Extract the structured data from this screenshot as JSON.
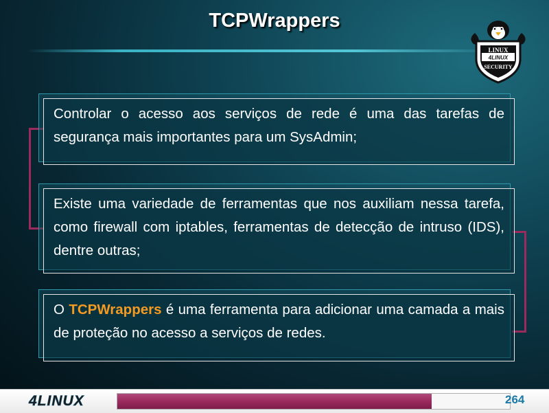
{
  "slide": {
    "title": "TCPWrappers",
    "badge": {
      "top_text": "LINUX",
      "middle_text": "4LINUX",
      "bottom_text": "SECURITY"
    }
  },
  "content": {
    "items": [
      {
        "text": "Controlar o acesso aos serviços de rede é uma das tarefas de segurança mais importantes para um SysAdmin;"
      },
      {
        "text": "Existe uma variedade de ferramentas que nos auxiliam nessa tarefa, como firewall com iptables, ferramentas de detecção de intruso (IDS), dentre outras;"
      },
      {
        "prefix": "O ",
        "highlight": "TCPWrappers",
        "suffix": " é uma ferramenta para adicionar uma camada a mais de proteção no acesso a serviços de redes."
      }
    ]
  },
  "footer": {
    "logo_text": "4LINUX",
    "progress": 0.8,
    "page_number": "264"
  },
  "colors": {
    "highlight": "#f39a22",
    "accent": "#9b2a5d",
    "page_number": "#1a7aa6"
  }
}
